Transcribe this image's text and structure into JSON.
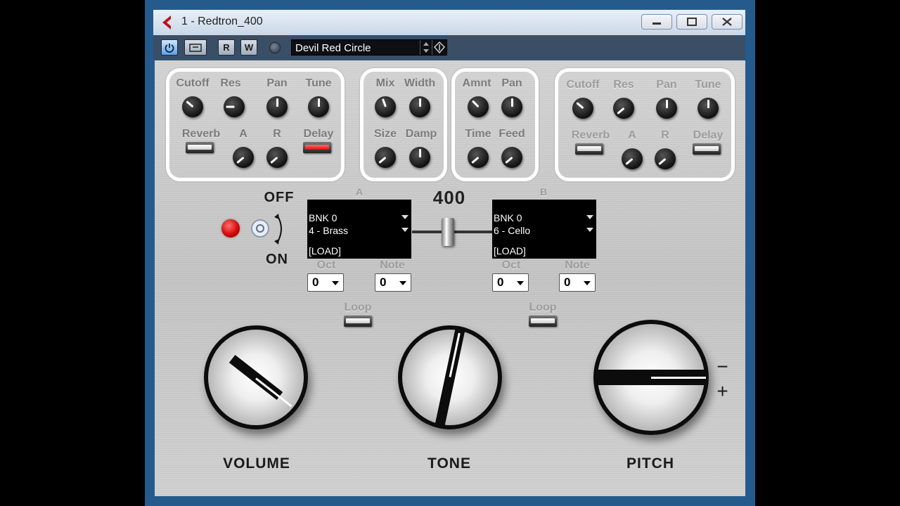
{
  "window": {
    "title": "1 - Redtron_400",
    "controls": [
      "minimize",
      "maximize",
      "close"
    ]
  },
  "toolbar": {
    "power_icon": "power-icon",
    "r_label": "R",
    "w_label": "W",
    "preset": "Devil Red Circle"
  },
  "effects_left": {
    "labels": [
      "Cutoff",
      "Res",
      "Pan",
      "Tune",
      "Reverb",
      "A",
      "R",
      "Delay"
    ],
    "delay_on": true
  },
  "reverb_section": {
    "labels": [
      "Mix",
      "Width",
      "Size",
      "Damp"
    ]
  },
  "delay_section": {
    "labels": [
      "Amnt",
      "Pan",
      "Time",
      "Feed"
    ]
  },
  "effects_right": {
    "labels": [
      "Cutoff",
      "Res",
      "Pan",
      "Tune",
      "Reverb",
      "A",
      "R",
      "Delay"
    ],
    "delay_on": false
  },
  "switch": {
    "off_label": "OFF",
    "on_label": "ON",
    "led_color": "#e01010"
  },
  "mixer": {
    "value": "400"
  },
  "channel_a": {
    "header": "A",
    "bank": "BNK  0",
    "sound": "4 - Brass",
    "load": "[LOAD]",
    "oct_label": "Oct",
    "note_label": "Note",
    "oct": "0",
    "note": "0",
    "loop_label": "Loop"
  },
  "channel_b": {
    "header": "B",
    "bank": "BNK  0",
    "sound": "6 - Cello",
    "load": "[LOAD]",
    "oct_label": "Oct",
    "note_label": "Note",
    "oct": "0",
    "note": "0",
    "loop_label": "Loop"
  },
  "big_knobs": {
    "volume": "VOLUME",
    "tone": "TONE",
    "pitch": "PITCH",
    "pitch_minus": "−",
    "pitch_plus": "+"
  }
}
